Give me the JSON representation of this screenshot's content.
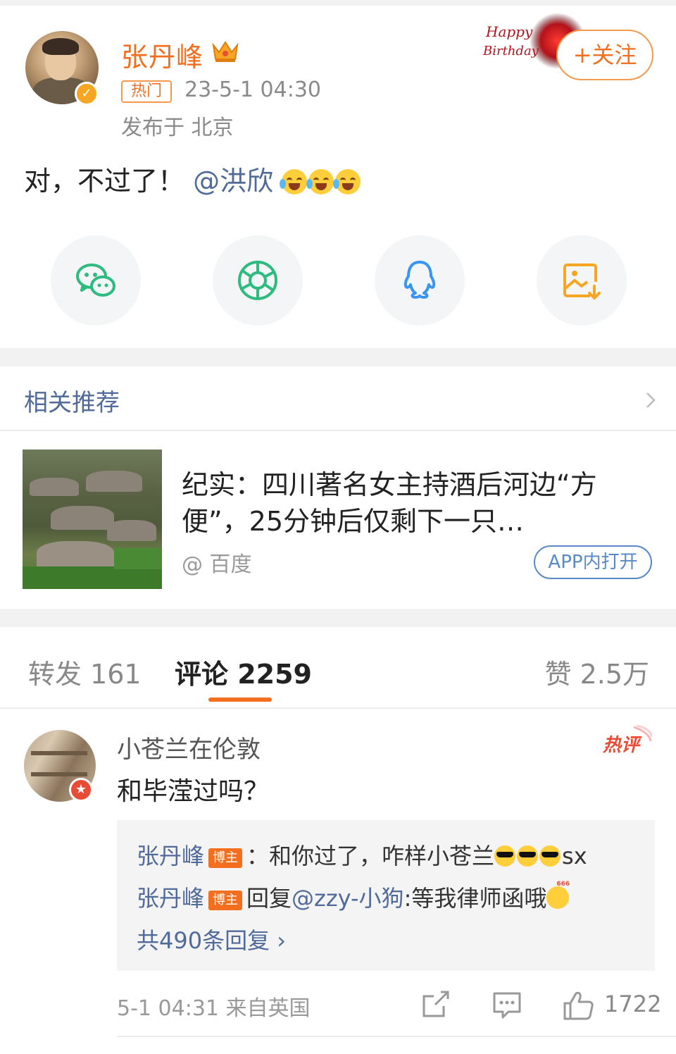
{
  "post": {
    "author": "张丹峰",
    "hot_tag": "热门",
    "time": "23-5-1 04:30",
    "location": "发布于 北京",
    "text_prefix": "对，不过了！",
    "mention": "@洪欣",
    "follow_label": "+关注",
    "decor_text": "Happy Birthday"
  },
  "share": {
    "items": [
      "wechat-icon",
      "moments-icon",
      "qq-icon",
      "save-image-icon"
    ],
    "colors": {
      "wechat": "#2dbb7f",
      "moments": "#2dbb7f",
      "qq": "#3a95f0",
      "save": "#f6a623"
    }
  },
  "related": {
    "title": "相关推荐",
    "item": {
      "title": "纪实：四川著名女主持酒后河边“方便”，25分钟后仅剩下一只…",
      "source": "@ 百度",
      "open_label": "APP内打开"
    }
  },
  "tabs": {
    "repost": "转发 161",
    "comment": "评论 2259",
    "likes": "赞 2.5万"
  },
  "comment": {
    "user": "小苍兰在伦敦",
    "text": "和毕滢过吗？",
    "hot_label": "热评",
    "replies": [
      {
        "name": "张丹峰",
        "tag": "博主",
        "text": "：和你过了，咋样小苍兰",
        "suffix": "sx"
      },
      {
        "name": "张丹峰",
        "tag": "博主",
        "prefix": "回复",
        "mention": "@zzy-小狗",
        "text": ":等我律师函哦"
      }
    ],
    "reply_total": "共490条回复 ›",
    "meta": "5-1 04:31 来自英国",
    "likes": "1722"
  },
  "colors": {
    "accent": "#f36e1f",
    "link": "#506a9a",
    "divider": "#f2f2f2"
  }
}
